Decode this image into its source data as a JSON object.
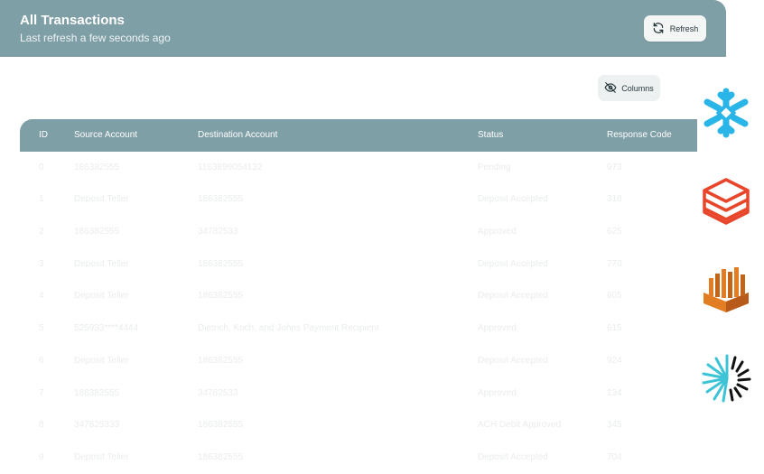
{
  "header": {
    "title": "All Transactions",
    "subtitle": "Last refresh a few seconds ago",
    "refresh_label": "Refresh"
  },
  "toolbar": {
    "columns_label": "Columns"
  },
  "table": {
    "columns": [
      "ID",
      "Source Account",
      "Destination Account",
      "Status",
      "Response Code"
    ],
    "rows": [
      {
        "id": "0",
        "source": "186382555",
        "destination": "1163899054132",
        "status": "Pending",
        "code": "973"
      },
      {
        "id": "1",
        "source": "Deposit Teller",
        "destination": "186382555",
        "status": "Deposit Accepted",
        "code": "318"
      },
      {
        "id": "2",
        "source": "186382555",
        "destination": "34782533",
        "status": "Approved",
        "code": "625"
      },
      {
        "id": "3",
        "source": "Deposit Teller",
        "destination": "186382555",
        "status": "Deposit Accepted",
        "code": "770"
      },
      {
        "id": "4",
        "source": "Deposit Teller",
        "destination": "186382555",
        "status": "Deposit Accepted",
        "code": "605"
      },
      {
        "id": "5",
        "source": "525933****4444",
        "destination": "Dietrich, Koch, and Johns Payment Recipient",
        "status": "Approved",
        "code": "615"
      },
      {
        "id": "6",
        "source": "Deposit Teller",
        "destination": "186382555",
        "status": "Deposit Accepted",
        "code": "924"
      },
      {
        "id": "7",
        "source": "186382555",
        "destination": "34782533",
        "status": "Approved",
        "code": "134"
      },
      {
        "id": "8",
        "source": "347825333",
        "destination": "186382555",
        "status": "ACH Debit Approved",
        "code": "345"
      },
      {
        "id": "9",
        "source": "Deposit Teller",
        "destination": "186382555",
        "status": "Deposit Accepted",
        "code": "704"
      }
    ]
  },
  "integrations": [
    {
      "icon": "snowflake-logo-icon",
      "color": "#29b5e8"
    },
    {
      "icon": "databricks-logo-icon",
      "color": "#e8462b"
    },
    {
      "icon": "aws-redshift-logo-icon",
      "color": "#e37d24"
    },
    {
      "icon": "starburst-logo-icon",
      "color": "#3cc4d6"
    }
  ]
}
